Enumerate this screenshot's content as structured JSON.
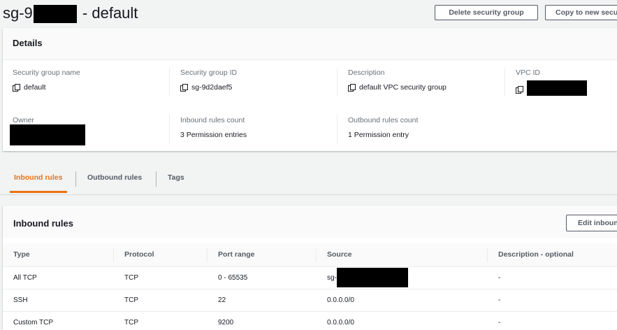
{
  "header": {
    "title_prefix": "sg-9",
    "title_suffix": "- default",
    "delete_button": "Delete security group",
    "copy_button": "Copy to new security group"
  },
  "details": {
    "title": "Details",
    "fields": {
      "sg_name": {
        "label": "Security group name",
        "value": "default"
      },
      "sg_id": {
        "label": "Security group ID",
        "value": "sg-9d2daef5"
      },
      "description": {
        "label": "Description",
        "value": "default VPC security group"
      },
      "vpc_id": {
        "label": "VPC ID",
        "value": ""
      },
      "owner": {
        "label": "Owner",
        "value": ""
      },
      "inbound_count": {
        "label": "Inbound rules count",
        "value": "3 Permission entries"
      },
      "outbound_count": {
        "label": "Outbound rules count",
        "value": "1 Permission entry"
      }
    }
  },
  "tabs": [
    {
      "label": "Inbound rules",
      "active": true
    },
    {
      "label": "Outbound rules",
      "active": false
    },
    {
      "label": "Tags",
      "active": false
    }
  ],
  "inbound": {
    "title": "Inbound rules",
    "edit_button": "Edit inbound rules",
    "columns": [
      "Type",
      "Protocol",
      "Port range",
      "Source",
      "Description - optional"
    ],
    "rows": [
      {
        "type": "All TCP",
        "protocol": "TCP",
        "port": "0 - 65535",
        "source": "sg-",
        "description": "-"
      },
      {
        "type": "SSH",
        "protocol": "TCP",
        "port": "22",
        "source": "0.0.0.0/0",
        "description": "-"
      },
      {
        "type": "Custom TCP",
        "protocol": "TCP",
        "port": "9200",
        "source": "0.0.0.0/0",
        "description": "-"
      }
    ]
  },
  "colors": {
    "accent": "#ec7211",
    "background": "#f2f3f3",
    "text": "#16191f",
    "muted": "#687078"
  },
  "icons": {
    "copy": "copy-icon"
  }
}
